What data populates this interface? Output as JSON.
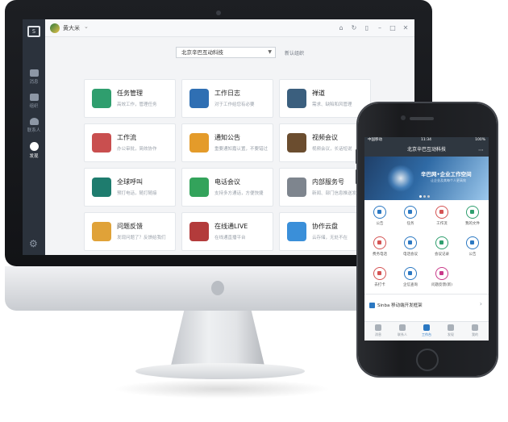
{
  "desktop": {
    "user_name": "黄大米",
    "org_selector_value": "北京辛巴互动科技",
    "new_org_label": "新认组织",
    "sidebar": {
      "items": [
        {
          "label": "消息"
        },
        {
          "label": "组织"
        },
        {
          "label": "联系人"
        },
        {
          "label": "发现"
        }
      ]
    },
    "apps": [
      {
        "name": "任务管理",
        "desc": "高效工作，管理任务",
        "icon": "task-icon",
        "color": "#2f9e6e"
      },
      {
        "name": "工作日志",
        "desc": "对于工作给您有必要",
        "icon": "journal-icon",
        "color": "#2f6fb3"
      },
      {
        "name": "禅道",
        "desc": "需求、缺陷和风管理",
        "icon": "zentao-icon",
        "color": "#3b5f7e"
      },
      {
        "name": "工作流",
        "desc": "办公审批，简效协作",
        "icon": "workflow-icon",
        "color": "#c94f4f"
      },
      {
        "name": "通知公告",
        "desc": "重要通知嘉认置，不要错过",
        "icon": "megaphone-icon",
        "color": "#e49b2a"
      },
      {
        "name": "视频会议",
        "desc": "视频会议，长话短说",
        "icon": "video-icon",
        "color": "#6b4d2f"
      },
      {
        "name": "全球呼叫",
        "desc": "预打电话，随打随接",
        "icon": "globe-icon",
        "color": "#1e7c6e"
      },
      {
        "name": "电话会议",
        "desc": "支持多方通话，方便快捷",
        "icon": "phone-icon",
        "color": "#33a35b"
      },
      {
        "name": "内部服务号",
        "desc": "新闻、部门信息推送发布",
        "icon": "service-icon",
        "color": "#7e858e"
      },
      {
        "name": "问题反馈",
        "desc": "发现问题了？反馈给我们",
        "icon": "feedback-icon",
        "color": "#e0a238"
      },
      {
        "name": "在线通LIVE",
        "desc": "在线通直播平台",
        "icon": "live-icon",
        "color": "#b33b3b"
      },
      {
        "name": "协作云盘",
        "desc": "云存储，无处不在",
        "icon": "cloud-icon",
        "color": "#3a8fd9"
      }
    ]
  },
  "mobile": {
    "status": {
      "carrier": "中国移动",
      "time": "11:34",
      "battery": "100%"
    },
    "header_title": "北京辛巴互动科技",
    "banner": {
      "title": "辛巴网•企业工作空间",
      "subtitle": "让企业及其每个人更高效"
    },
    "apps": [
      {
        "label": "公告",
        "icon": "megaphone-icon",
        "color": "#2b78c2"
      },
      {
        "label": "任务",
        "icon": "task-icon",
        "color": "#2b78c2"
      },
      {
        "label": "工作流",
        "icon": "workflow-icon",
        "color": "#d45353"
      },
      {
        "label": "我的文件",
        "icon": "folder-icon",
        "color": "#2f9e6e"
      },
      {
        "label": "费务电话",
        "icon": "phone-icon",
        "color": "#d45353"
      },
      {
        "label": "电话会议",
        "icon": "conference-icon",
        "color": "#2b78c2"
      },
      {
        "label": "会议记录",
        "icon": "notes-icon",
        "color": "#2f9e6e"
      },
      {
        "label": "公告",
        "icon": "speaker-icon",
        "color": "#2b78c2"
      },
      {
        "label": "去打卡",
        "icon": "checkin-icon",
        "color": "#d45353"
      },
      {
        "label": "企信查询",
        "icon": "search-icon",
        "color": "#2b78c2"
      },
      {
        "label": "问题反馈(新)",
        "icon": "feedback-icon",
        "color": "#c93a8a"
      }
    ],
    "sinba_link": "Sinba 移动端开发框架",
    "tabs": [
      {
        "label": "消息"
      },
      {
        "label": "联系人"
      },
      {
        "label": "工作台"
      },
      {
        "label": "发现"
      },
      {
        "label": "我的"
      }
    ]
  }
}
